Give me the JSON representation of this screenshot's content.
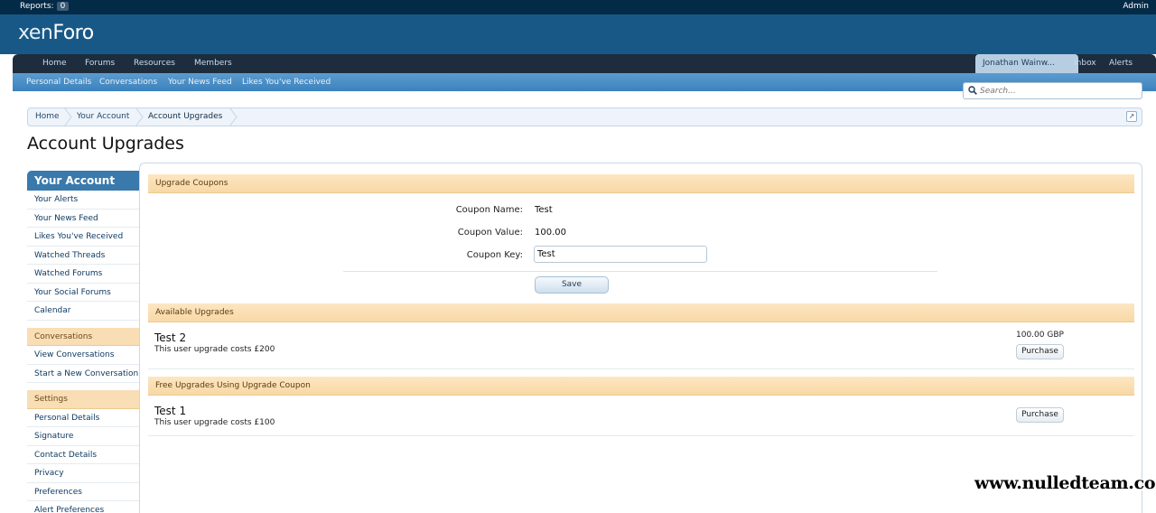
{
  "adminbar": {
    "reports_label": "Reports:",
    "reports_count": "0",
    "admin_label": "Admin"
  },
  "logo": {
    "text_a": "xen",
    "text_b": "Foro"
  },
  "nav": {
    "tabs": [
      "Home",
      "Forums",
      "Resources",
      "Members"
    ],
    "user": "Jonathan Wainw...",
    "inbox": "Inbox",
    "alerts": "Alerts"
  },
  "subnav": {
    "links": [
      "Personal Details",
      "Conversations",
      "Your News Feed",
      "Likes You've Received"
    ]
  },
  "search": {
    "placeholder": "Search..."
  },
  "breadcrumb": {
    "items": [
      "Home",
      "Your Account",
      "Account Upgrades"
    ]
  },
  "page_title": "Account Upgrades",
  "sidebar": {
    "header": "Your Account",
    "account_items": [
      "Your Alerts",
      "Your News Feed",
      "Likes You've Received",
      "Watched Threads",
      "Watched Forums",
      "Your Social Forums",
      "Calendar"
    ],
    "conversations_header": "Conversations",
    "conversation_items": [
      "View Conversations",
      "Start a New Conversation"
    ],
    "settings_header": "Settings",
    "settings_items": [
      "Personal Details",
      "Signature",
      "Contact Details",
      "Privacy",
      "Preferences",
      "Alert Preferences"
    ]
  },
  "coupons": {
    "header": "Upgrade Coupons",
    "name_label": "Coupon Name:",
    "name_value": "Test",
    "value_label": "Coupon Value:",
    "value_value": "100.00",
    "key_label": "Coupon Key:",
    "key_value": "Test",
    "save_label": "Save"
  },
  "available": {
    "header": "Available Upgrades",
    "items": [
      {
        "title": "Test 2",
        "desc": "This user upgrade costs £200",
        "price": "100.00 GBP",
        "button": "Purchase"
      }
    ]
  },
  "free": {
    "header": "Free Upgrades Using Upgrade Coupon",
    "items": [
      {
        "title": "Test 1",
        "desc": "This user upgrade costs £100",
        "button": "Purchase"
      }
    ]
  },
  "watermark": "www.nulledteam.com"
}
